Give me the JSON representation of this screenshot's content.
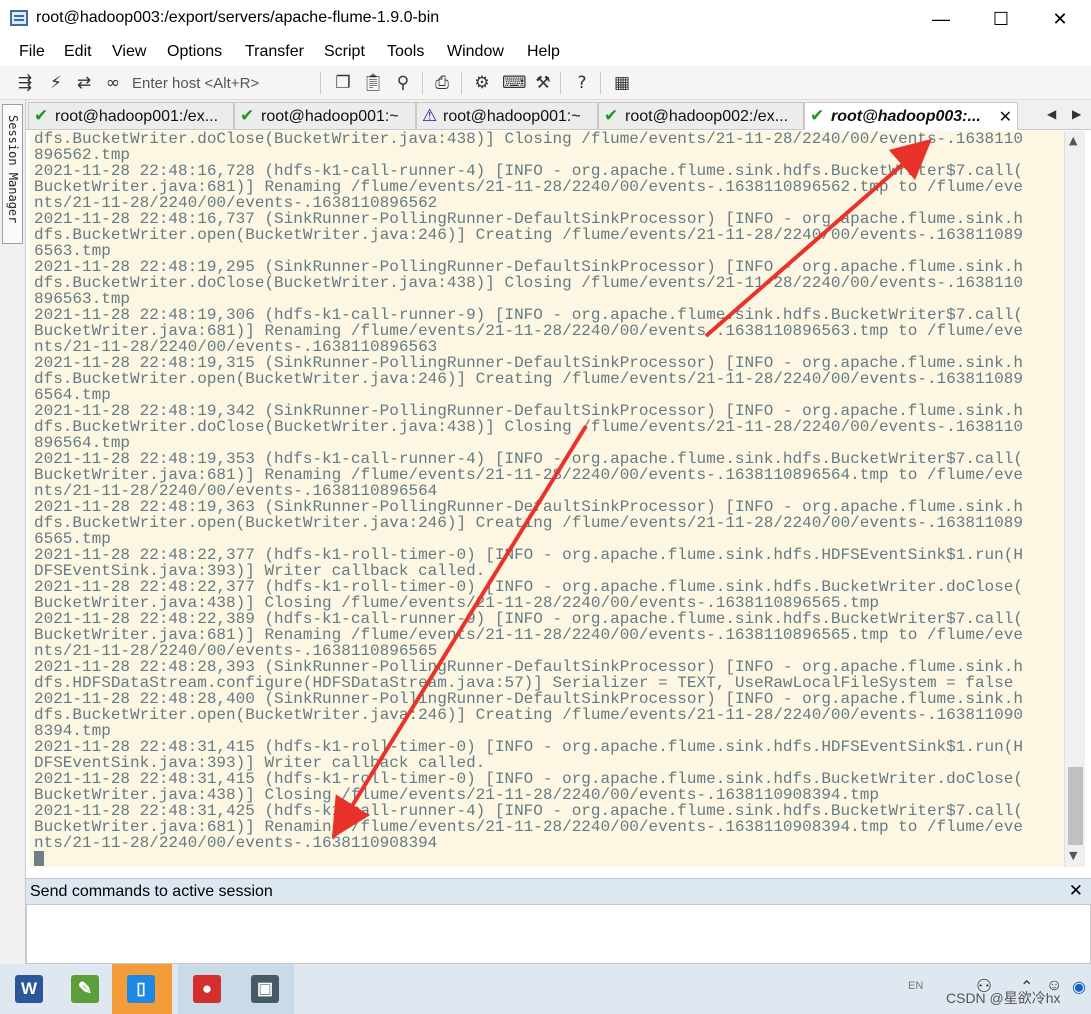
{
  "window": {
    "title": "root@hadoop003:/export/servers/apache-flume-1.9.0-bin",
    "controls": {
      "minimize": "—",
      "maximize": "☐",
      "close": "✕"
    }
  },
  "menu": [
    "File",
    "Edit",
    "View",
    "Options",
    "Transfer",
    "Script",
    "Tools",
    "Window",
    "Help"
  ],
  "toolbar": {
    "host_placeholder": "Enter host <Alt+R>",
    "icons": [
      "connect-icon",
      "lightning-icon",
      "reconnect-icon",
      "link-icon",
      "copy-icon",
      "paste-icon",
      "find-icon",
      "print-icon",
      "settings-icon",
      "keymap-icon",
      "sftp-icon",
      "help-icon",
      "map-icon"
    ]
  },
  "session_manager": {
    "label": "Session Manager"
  },
  "tabs": [
    {
      "label": "root@hadoop001:/ex...",
      "status": "ok",
      "icon": "✔"
    },
    {
      "label": "root@hadoop001:~",
      "status": "ok",
      "icon": "✔"
    },
    {
      "label": "root@hadoop001:~",
      "status": "warning",
      "icon": "⚠"
    },
    {
      "label": "root@hadoop002:/ex...",
      "status": "ok",
      "icon": "✔"
    },
    {
      "label": "root@hadoop003:...",
      "status": "ok",
      "icon": "✔",
      "active": true,
      "close": "✕"
    }
  ],
  "tab_nav": {
    "prev": "◀",
    "next": "▶"
  },
  "terminal": {
    "background": "#fdf6e3",
    "foreground": "#657b83",
    "lines": [
      "dfs.BucketWriter.doClose(BucketWriter.java:438)] Closing /flume/events/21-11-28/2240/00/events-.1638110",
      "896562.tmp",
      "2021-11-28 22:48:16,728 (hdfs-k1-call-runner-4) [INFO - org.apache.flume.sink.hdfs.BucketWriter$7.call(",
      "BucketWriter.java:681)] Renaming /flume/events/21-11-28/2240/00/events-.1638110896562.tmp to /flume/eve",
      "nts/21-11-28/2240/00/events-.1638110896562",
      "2021-11-28 22:48:16,737 (SinkRunner-PollingRunner-DefaultSinkProcessor) [INFO - org.apache.flume.sink.h",
      "dfs.BucketWriter.open(BucketWriter.java:246)] Creating /flume/events/21-11-28/2240/00/events-.163811089",
      "6563.tmp",
      "2021-11-28 22:48:19,295 (SinkRunner-PollingRunner-DefaultSinkProcessor) [INFO - org.apache.flume.sink.h",
      "dfs.BucketWriter.doClose(BucketWriter.java:438)] Closing /flume/events/21-11-28/2240/00/events-.1638110",
      "896563.tmp",
      "2021-11-28 22:48:19,306 (hdfs-k1-call-runner-9) [INFO - org.apache.flume.sink.hdfs.BucketWriter$7.call(",
      "BucketWriter.java:681)] Renaming /flume/events/21-11-28/2240/00/events-.1638110896563.tmp to /flume/eve",
      "nts/21-11-28/2240/00/events-.1638110896563",
      "2021-11-28 22:48:19,315 (SinkRunner-PollingRunner-DefaultSinkProcessor) [INFO - org.apache.flume.sink.h",
      "dfs.BucketWriter.open(BucketWriter.java:246)] Creating /flume/events/21-11-28/2240/00/events-.163811089",
      "6564.tmp",
      "2021-11-28 22:48:19,342 (SinkRunner-PollingRunner-DefaultSinkProcessor) [INFO - org.apache.flume.sink.h",
      "dfs.BucketWriter.doClose(BucketWriter.java:438)] Closing /flume/events/21-11-28/2240/00/events-.1638110",
      "896564.tmp",
      "2021-11-28 22:48:19,353 (hdfs-k1-call-runner-4) [INFO - org.apache.flume.sink.hdfs.BucketWriter$7.call(",
      "BucketWriter.java:681)] Renaming /flume/events/21-11-28/2240/00/events-.1638110896564.tmp to /flume/eve",
      "nts/21-11-28/2240/00/events-.1638110896564",
      "2021-11-28 22:48:19,363 (SinkRunner-PollingRunner-DefaultSinkProcessor) [INFO - org.apache.flume.sink.h",
      "dfs.BucketWriter.open(BucketWriter.java:246)] Creating /flume/events/21-11-28/2240/00/events-.163811089",
      "6565.tmp",
      "2021-11-28 22:48:22,377 (hdfs-k1-roll-timer-0) [INFO - org.apache.flume.sink.hdfs.HDFSEventSink$1.run(H",
      "DFSEventSink.java:393)] Writer callback called.",
      "2021-11-28 22:48:22,377 (hdfs-k1-roll-timer-0) [INFO - org.apache.flume.sink.hdfs.BucketWriter.doClose(",
      "BucketWriter.java:438)] Closing /flume/events/21-11-28/2240/00/events-.1638110896565.tmp",
      "2021-11-28 22:48:22,389 (hdfs-k1-call-runner-9) [INFO - org.apache.flume.sink.hdfs.BucketWriter$7.call(",
      "BucketWriter.java:681)] Renaming /flume/events/21-11-28/2240/00/events-.1638110896565.tmp to /flume/eve",
      "nts/21-11-28/2240/00/events-.1638110896565",
      "2021-11-28 22:48:28,393 (SinkRunner-PollingRunner-DefaultSinkProcessor) [INFO - org.apache.flume.sink.h",
      "dfs.HDFSDataStream.configure(HDFSDataStream.java:57)] Serializer = TEXT, UseRawLocalFileSystem = false",
      "2021-11-28 22:48:28,400 (SinkRunner-PollingRunner-DefaultSinkProcessor) [INFO - org.apache.flume.sink.h",
      "dfs.BucketWriter.open(BucketWriter.java:246)] Creating /flume/events/21-11-28/2240/00/events-.163811090",
      "8394.tmp",
      "2021-11-28 22:48:31,415 (hdfs-k1-roll-timer-0) [INFO - org.apache.flume.sink.hdfs.HDFSEventSink$1.run(H",
      "DFSEventSink.java:393)] Writer callback called.",
      "2021-11-28 22:48:31,415 (hdfs-k1-roll-timer-0) [INFO - org.apache.flume.sink.hdfs.BucketWriter.doClose(",
      "BucketWriter.java:438)] Closing /flume/events/21-11-28/2240/00/events-.1638110908394.tmp",
      "2021-11-28 22:48:31,425 (hdfs-k1-call-runner-4) [INFO - org.apache.flume.sink.hdfs.BucketWriter$7.call(",
      "BucketWriter.java:681)] Renaming /flume/events/21-11-28/2240/00/events-.1638110908394.tmp to /flume/eve",
      "nts/21-11-28/2240/00/events-.1638110908394"
    ],
    "annotation_color": "#e8332b"
  },
  "scrollbar": {
    "up": "▲",
    "down": "▼"
  },
  "command_window": {
    "title": "Send commands to active session",
    "close": "✕"
  },
  "taskbar": {
    "apps": [
      {
        "name": "word-icon",
        "glyph": "W",
        "color": "#2b579a"
      },
      {
        "name": "notepad-icon",
        "glyph": "✎",
        "color": "#5e9e3a"
      },
      {
        "name": "phone-icon",
        "glyph": "▯",
        "color": "#1e88e5"
      },
      {
        "name": "recorder-icon",
        "glyph": "●",
        "color": "#d32f2f"
      },
      {
        "name": "securecrt-icon",
        "glyph": "▣",
        "color": "#455a64"
      }
    ],
    "tray": {
      "lang": "EN",
      "watermark": "CSDN @星欲冷hx"
    }
  }
}
